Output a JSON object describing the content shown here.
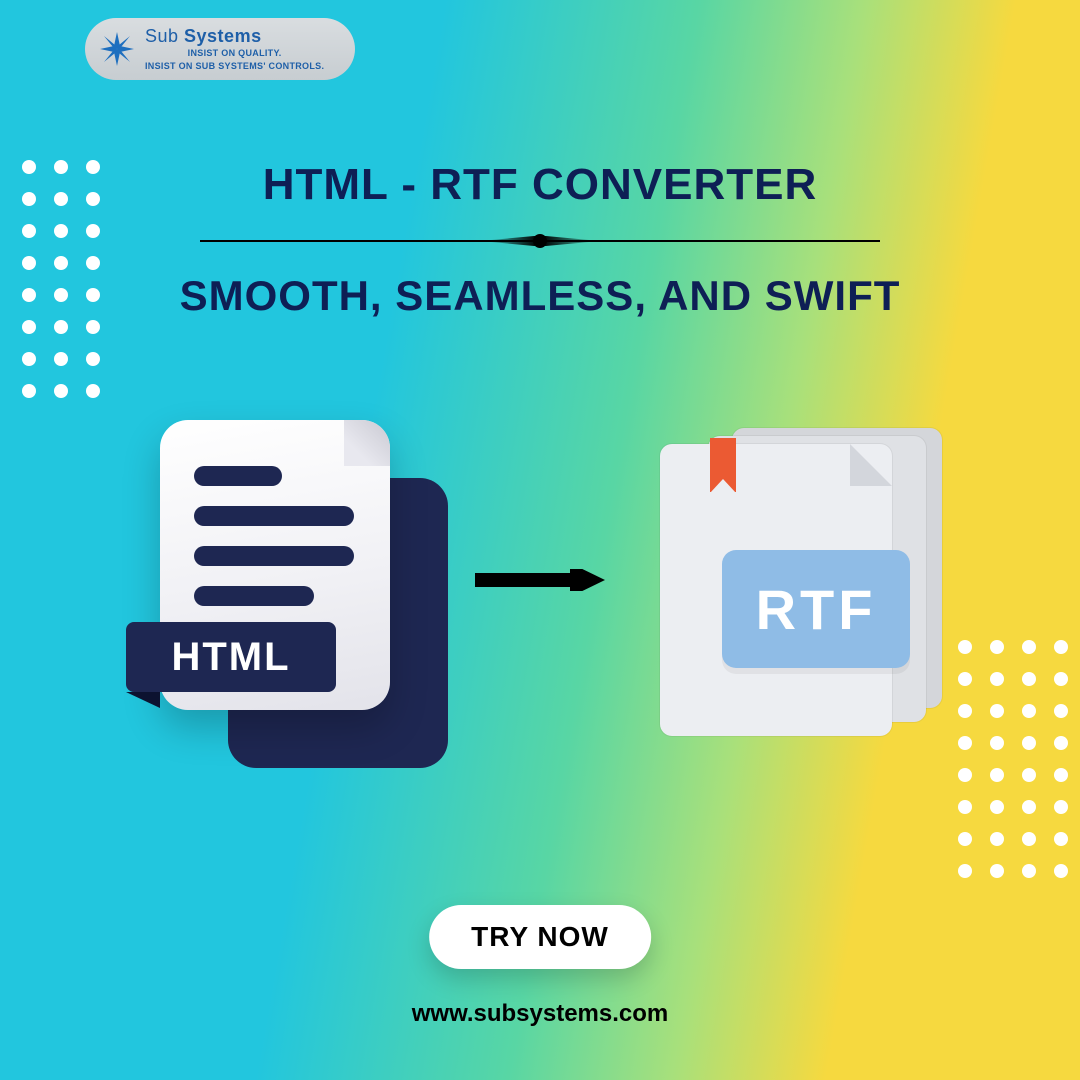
{
  "brand": {
    "name_a": "Sub ",
    "name_b": "Systems",
    "tagline1": "INSIST ON QUALITY.",
    "tagline2": "INSIST ON SUB SYSTEMS' CONTROLS."
  },
  "headline": {
    "title": "HTML - RTF CONVERTER",
    "subtitle": "SMOOTH, SEAMLESS, AND SWIFT"
  },
  "icons": {
    "html_label": "HTML",
    "rtf_label": "RTF"
  },
  "cta": {
    "label": "TRY NOW"
  },
  "footer": {
    "url": "www.subsystems.com"
  }
}
